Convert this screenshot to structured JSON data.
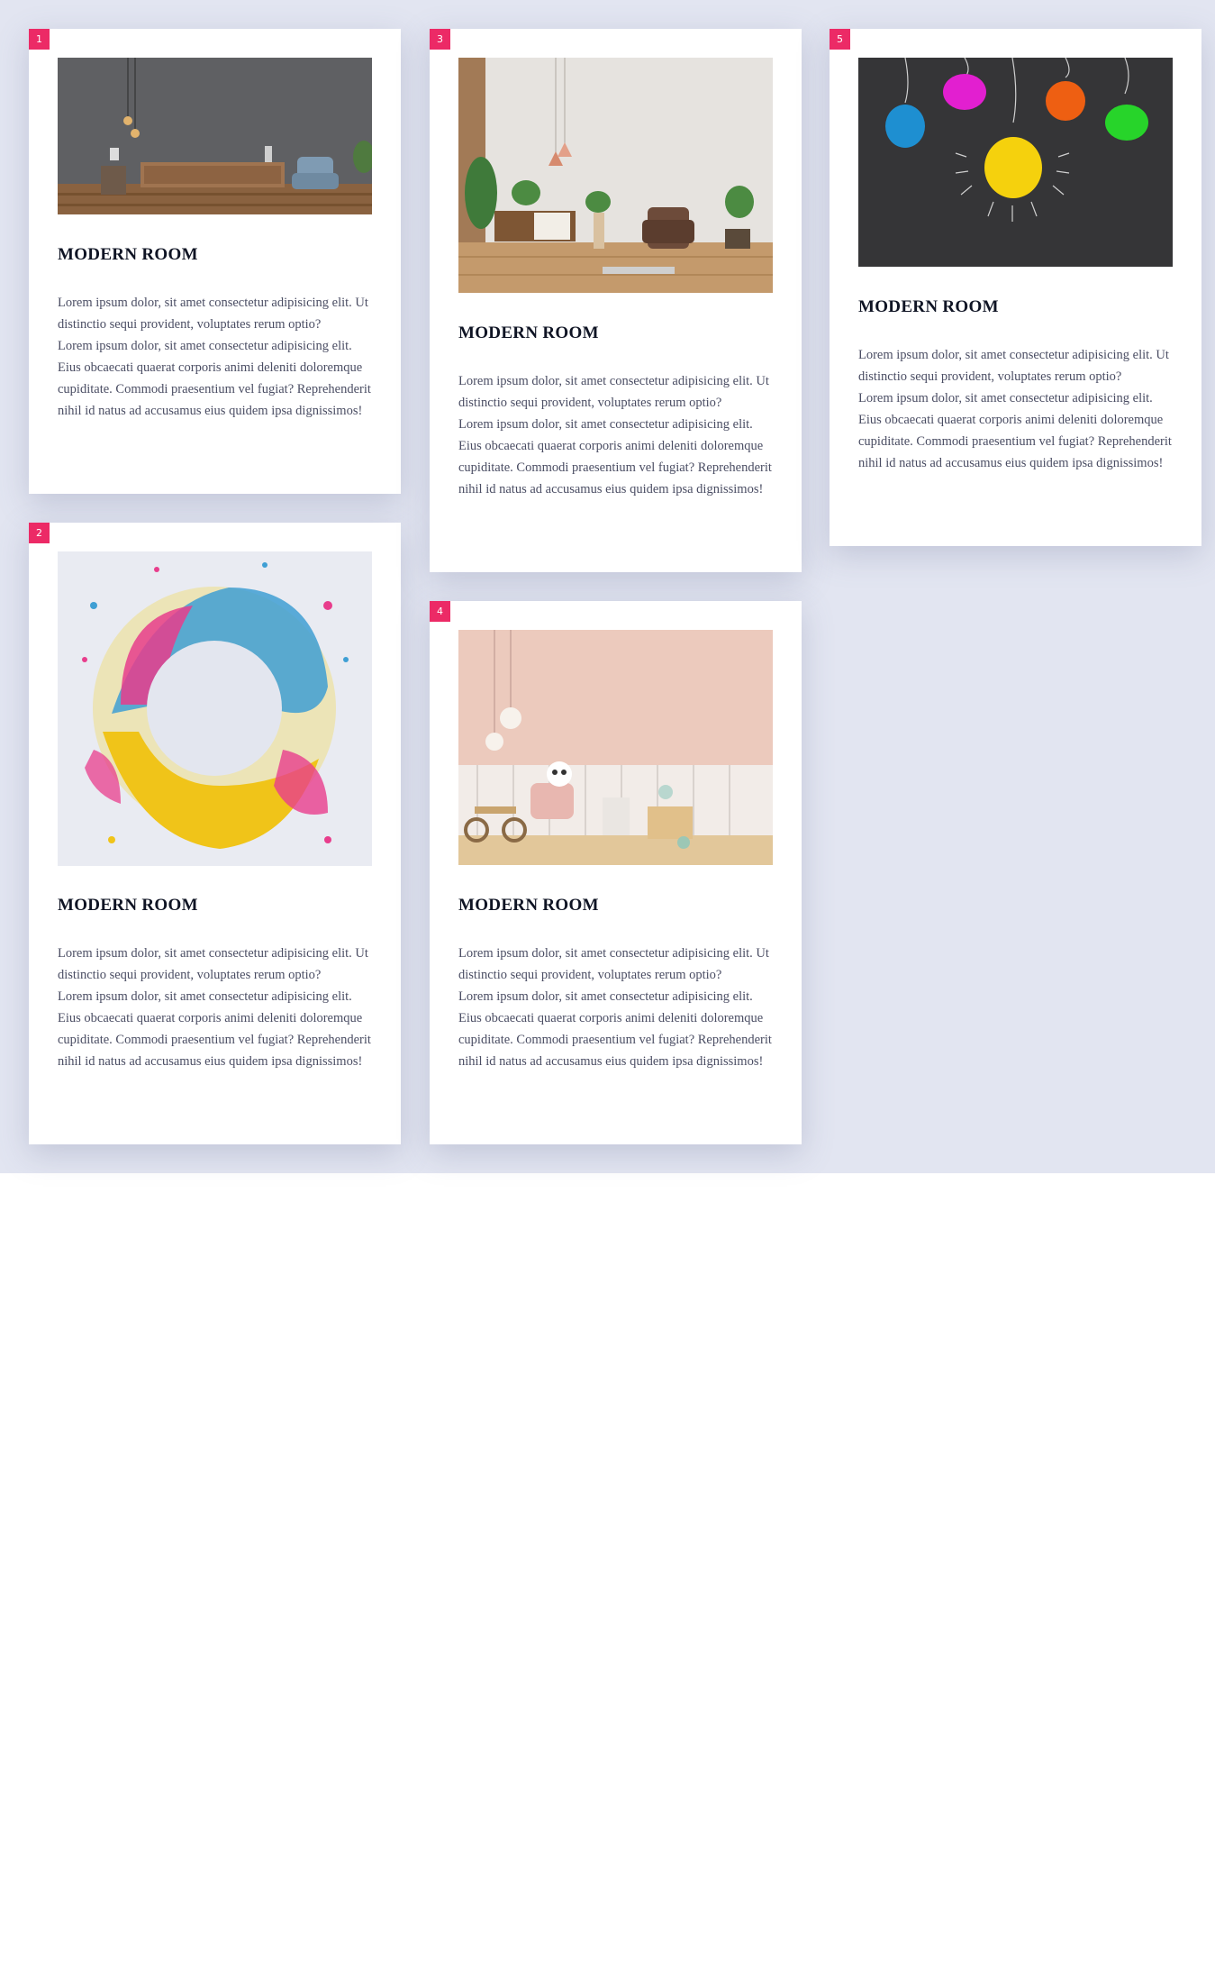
{
  "cards": [
    {
      "badge": "1",
      "image": "living-room-dark-wall",
      "title": "MODERN ROOM",
      "para1": "Lorem ipsum dolor, sit amet consectetur adipisicing elit. Ut distinctio sequi provident, voluptates rerum optio?",
      "para2": "Lorem ipsum dolor, sit amet consectetur adipisicing elit. Eius obcaecati quaerat corporis animi deleniti doloremque cupiditate. Commodi praesentium vel fugiat? Reprehenderit nihil id natus ad accusamus eius quidem ipsa dignissimos!"
    },
    {
      "badge": "2",
      "image": "color-powder-splash",
      "title": "MODERN ROOM",
      "para1": "Lorem ipsum dolor, sit amet consectetur adipisicing elit. Ut distinctio sequi provident, voluptates rerum optio?",
      "para2": "Lorem ipsum dolor, sit amet consectetur adipisicing elit. Eius obcaecati quaerat corporis animi deleniti doloremque cupiditate. Commodi praesentium vel fugiat? Reprehenderit nihil id natus ad accusamus eius quidem ipsa dignissimos!"
    },
    {
      "badge": "3",
      "image": "living-room-white-wall",
      "title": "MODERN ROOM",
      "para1": "Lorem ipsum dolor, sit amet consectetur adipisicing elit. Ut distinctio sequi provident, voluptates rerum optio?",
      "para2": "Lorem ipsum dolor, sit amet consectetur adipisicing elit. Eius obcaecati quaerat corporis animi deleniti doloremque cupiditate. Commodi praesentium vel fugiat? Reprehenderit nihil id natus ad accusamus eius quidem ipsa dignissimos!"
    },
    {
      "badge": "4",
      "image": "kids-room-pink-wall",
      "title": "MODERN ROOM",
      "para1": "Lorem ipsum dolor, sit amet consectetur adipisicing elit. Ut distinctio sequi provident, voluptates rerum optio?",
      "para2": "Lorem ipsum dolor, sit amet consectetur adipisicing elit. Eius obcaecati quaerat corporis animi deleniti doloremque cupiditate. Commodi praesentium vel fugiat? Reprehenderit nihil id natus ad accusamus eius quidem ipsa dignissimos!"
    },
    {
      "badge": "5",
      "image": "paper-lightbulbs-chalkboard",
      "title": "MODERN ROOM",
      "para1": "Lorem ipsum dolor, sit amet consectetur adipisicing elit. Ut distinctio sequi provident, voluptates rerum optio?",
      "para2": "Lorem ipsum dolor, sit amet consectetur adipisicing elit. Eius obcaecati quaerat corporis animi deleniti doloremque cupiditate. Commodi praesentium vel fugiat? Reprehenderit nihil id natus ad accusamus eius quidem ipsa dignissimos!"
    }
  ],
  "colors": {
    "accent": "#ec2a66",
    "page_background": "#e2e5f1",
    "card_background": "#ffffff",
    "title_text": "#0f1424",
    "body_text": "#4a4d63"
  }
}
